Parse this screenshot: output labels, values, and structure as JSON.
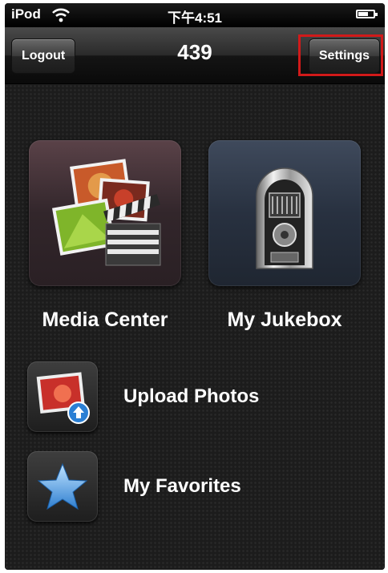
{
  "status_bar": {
    "carrier": "iPod",
    "time": "下午4:51"
  },
  "nav_bar": {
    "logout_label": "Logout",
    "title": "439",
    "settings_label": "Settings"
  },
  "tiles": {
    "media_center": "Media Center",
    "my_jukebox": "My Jukebox"
  },
  "menu": {
    "upload_photos": "Upload Photos",
    "my_favorites": "My Favorites"
  },
  "colors": {
    "highlight": "#d11a1a"
  }
}
